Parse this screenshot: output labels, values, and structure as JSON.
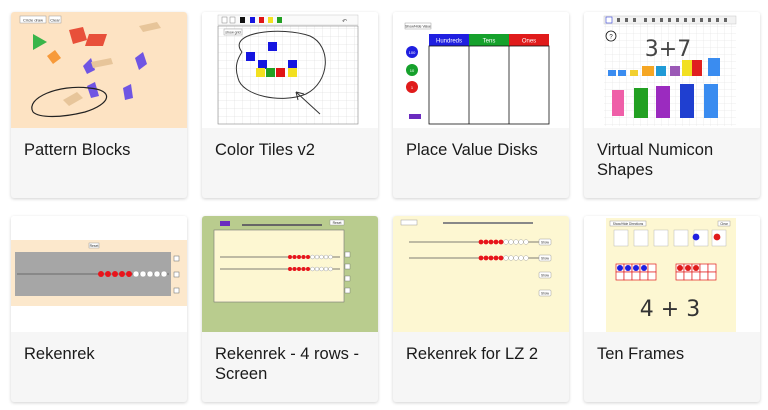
{
  "cards": [
    {
      "title": "Pattern Blocks",
      "thumb_labels": [
        "Circle draw",
        "Clear"
      ]
    },
    {
      "title": "Color Tiles v2",
      "thumb_labels": [
        "show grid"
      ]
    },
    {
      "title": "Place Value Disks",
      "thumb_labels": [
        "Show/Hide Value",
        "Hundreds",
        "Tens",
        "Ones",
        "100",
        "10",
        "1"
      ]
    },
    {
      "title": "Virtual Numicon Shapes",
      "thumb_labels": [
        "3+7",
        "?"
      ]
    },
    {
      "title": "Rekenrek",
      "thumb_labels": [
        "Reset"
      ]
    },
    {
      "title": "Rekenrek - 4 rows - Screen",
      "thumb_labels": [
        "Reset"
      ]
    },
    {
      "title": "Rekenrek for LZ 2",
      "thumb_labels": [
        "Show",
        "Show",
        "Show",
        "Show"
      ]
    },
    {
      "title": "Ten Frames",
      "thumb_labels": [
        "Show/Hide Directions",
        "Clear",
        "4 + 3"
      ]
    }
  ],
  "colors": {
    "card_bg": "#f6f6f6",
    "pattern_bg": "#fde3c3",
    "rekenrek_bg": "#fce8cc",
    "lz_bg": "#fdf7d2",
    "screen_green": "#b9cc8e",
    "bead_red": "#e8141b",
    "hundreds": "#1f1fe0",
    "tens": "#16a12c",
    "ones": "#e01b1b"
  }
}
